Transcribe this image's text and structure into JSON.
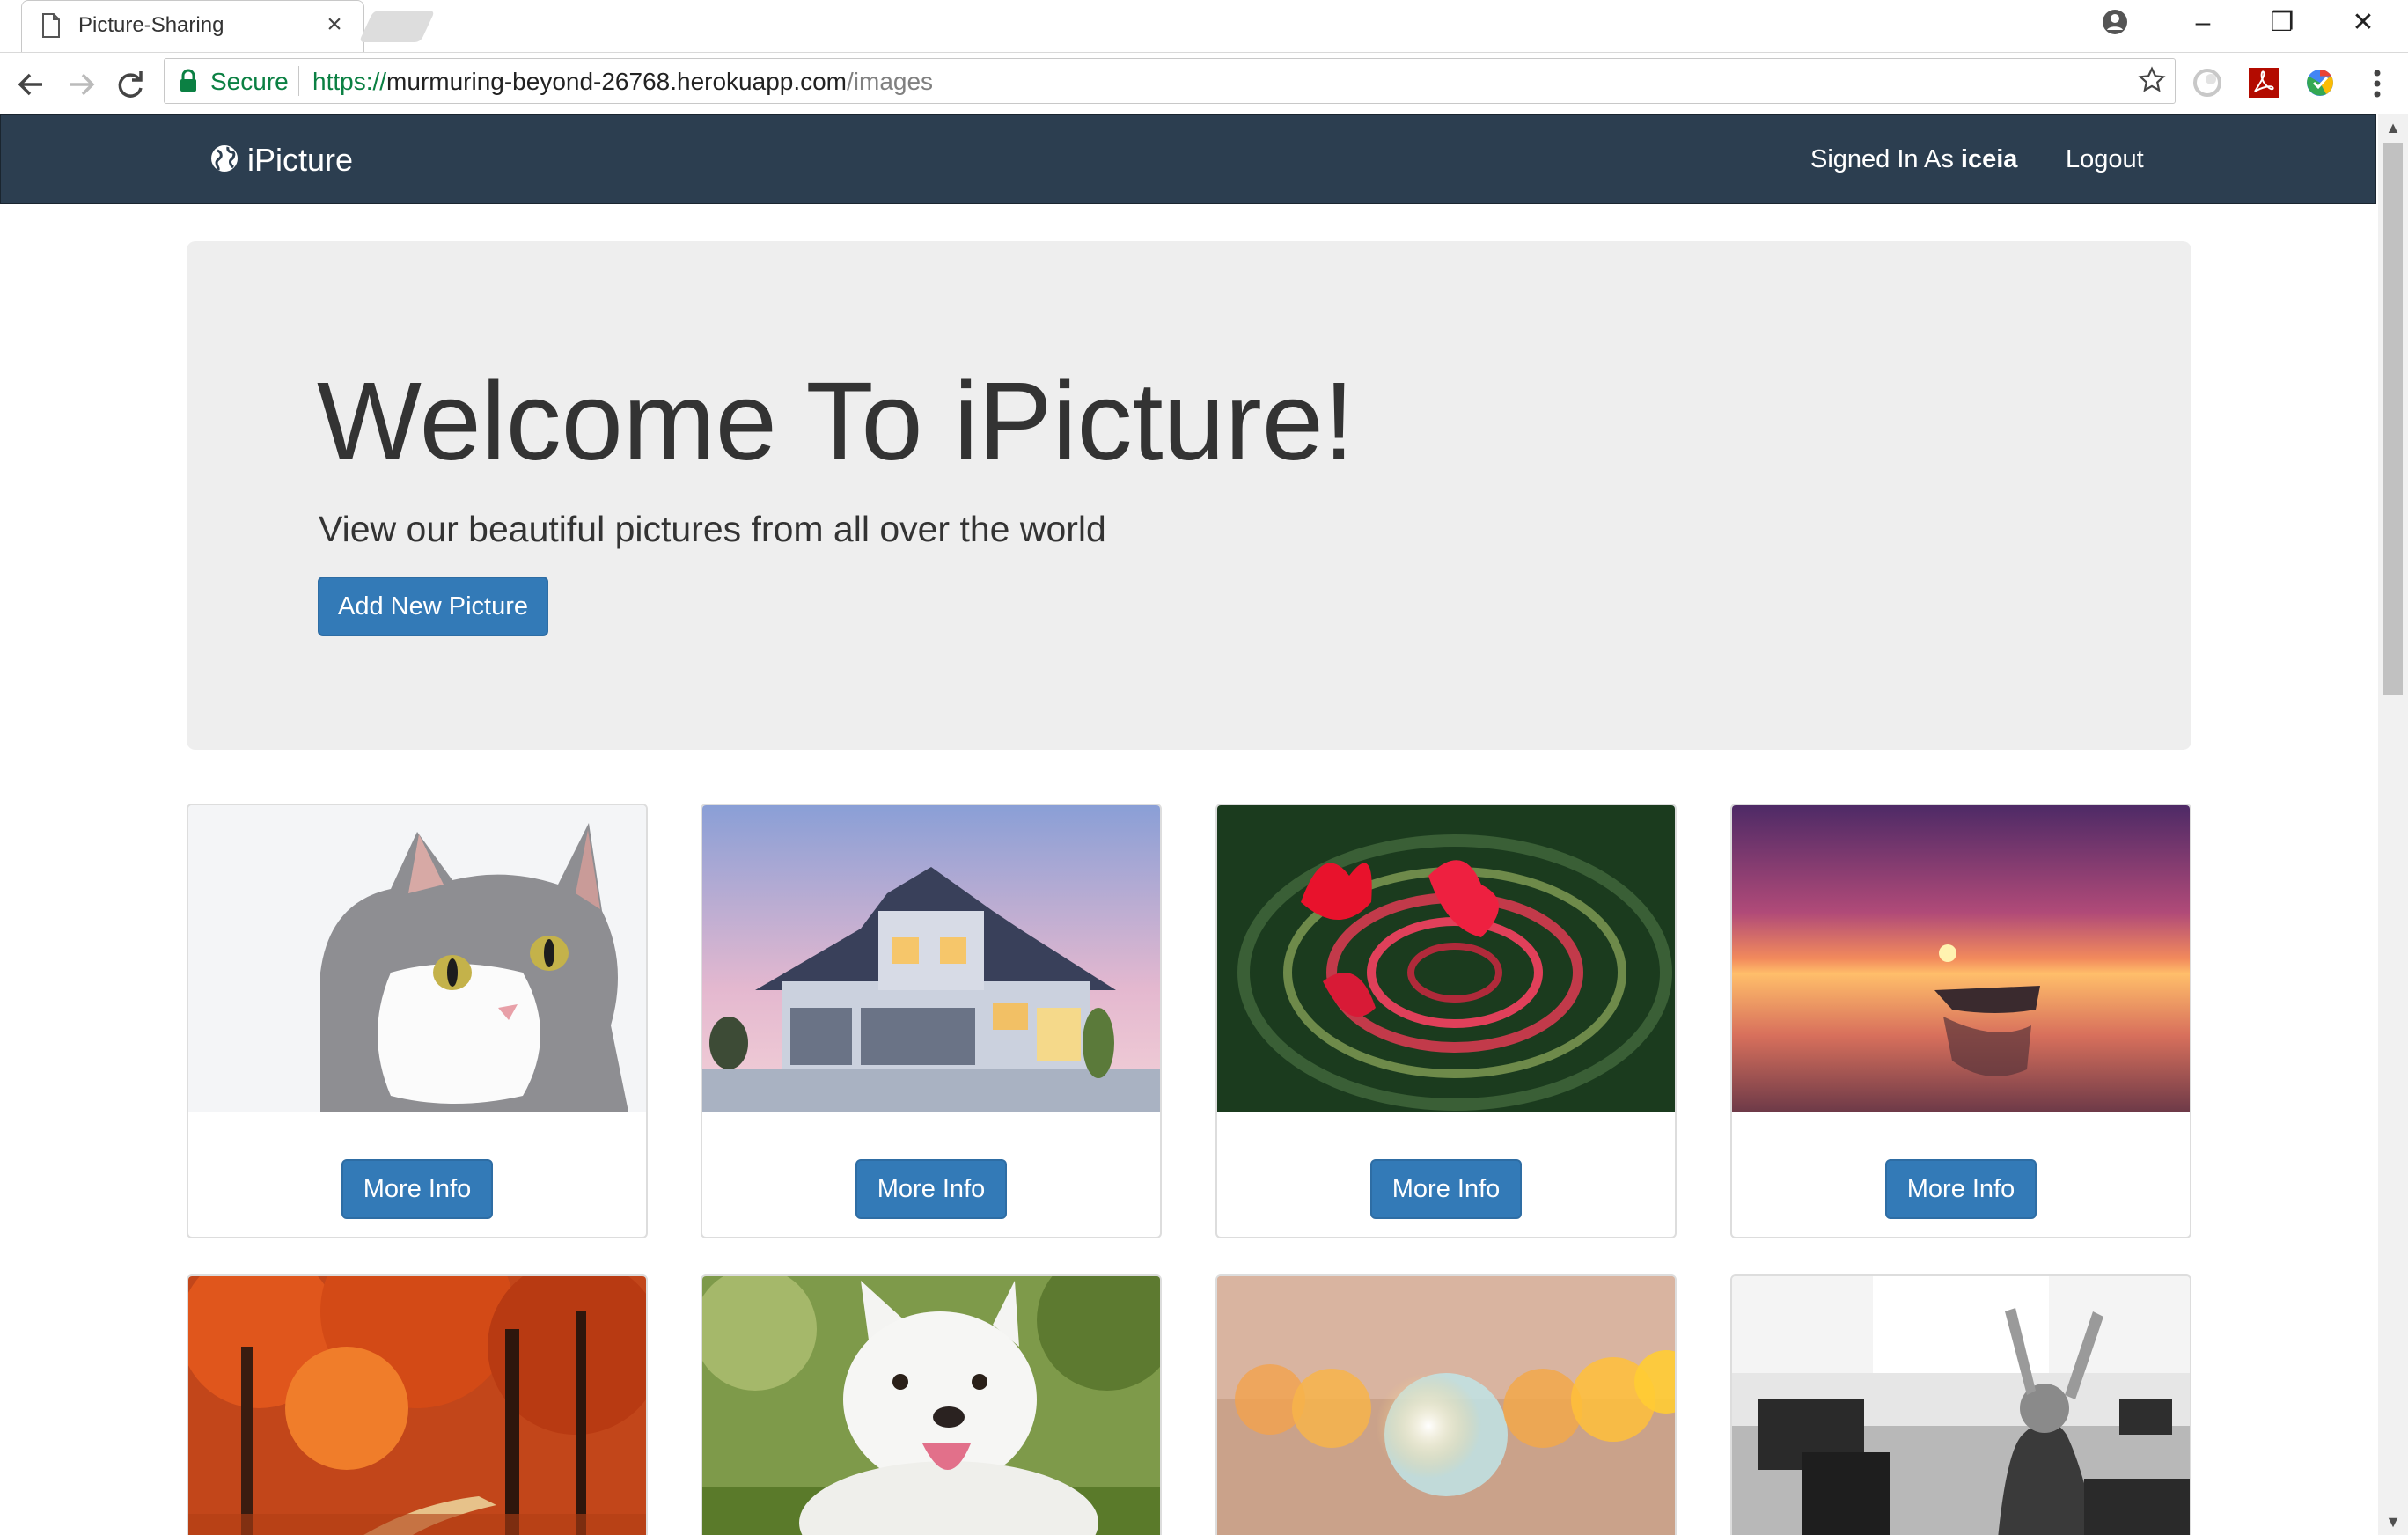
{
  "browser": {
    "tab_title": "Picture-Sharing",
    "tab_close": "×",
    "secure_label": "Secure",
    "url_scheme": "https://",
    "url_host": "murmuring-beyond-26768.herokuapp.com",
    "url_path": "/images",
    "window_controls": {
      "minimize": "–",
      "restore": "❐",
      "close": "✕"
    }
  },
  "navbar": {
    "brand": "iPicture",
    "signed_in_prefix": "Signed In As",
    "username": "iceia",
    "logout": "Logout"
  },
  "jumbotron": {
    "title": "Welcome To iPicture!",
    "subtitle": "View our beautiful pictures from all over the world",
    "add_button": "Add New Picture"
  },
  "gallery": {
    "button_label": "More Info",
    "items": [
      {
        "name": "cat"
      },
      {
        "name": "house"
      },
      {
        "name": "flower-ripples"
      },
      {
        "name": "sunset-boat"
      },
      {
        "name": "autumn-forest"
      },
      {
        "name": "white-dog"
      },
      {
        "name": "bokeh-lights"
      },
      {
        "name": "office-stretch"
      }
    ]
  },
  "colors": {
    "navbar_bg": "#2c3e50",
    "primary": "#337ab7",
    "jumbotron_bg": "#eeeeee",
    "secure_green": "#0b8043"
  }
}
